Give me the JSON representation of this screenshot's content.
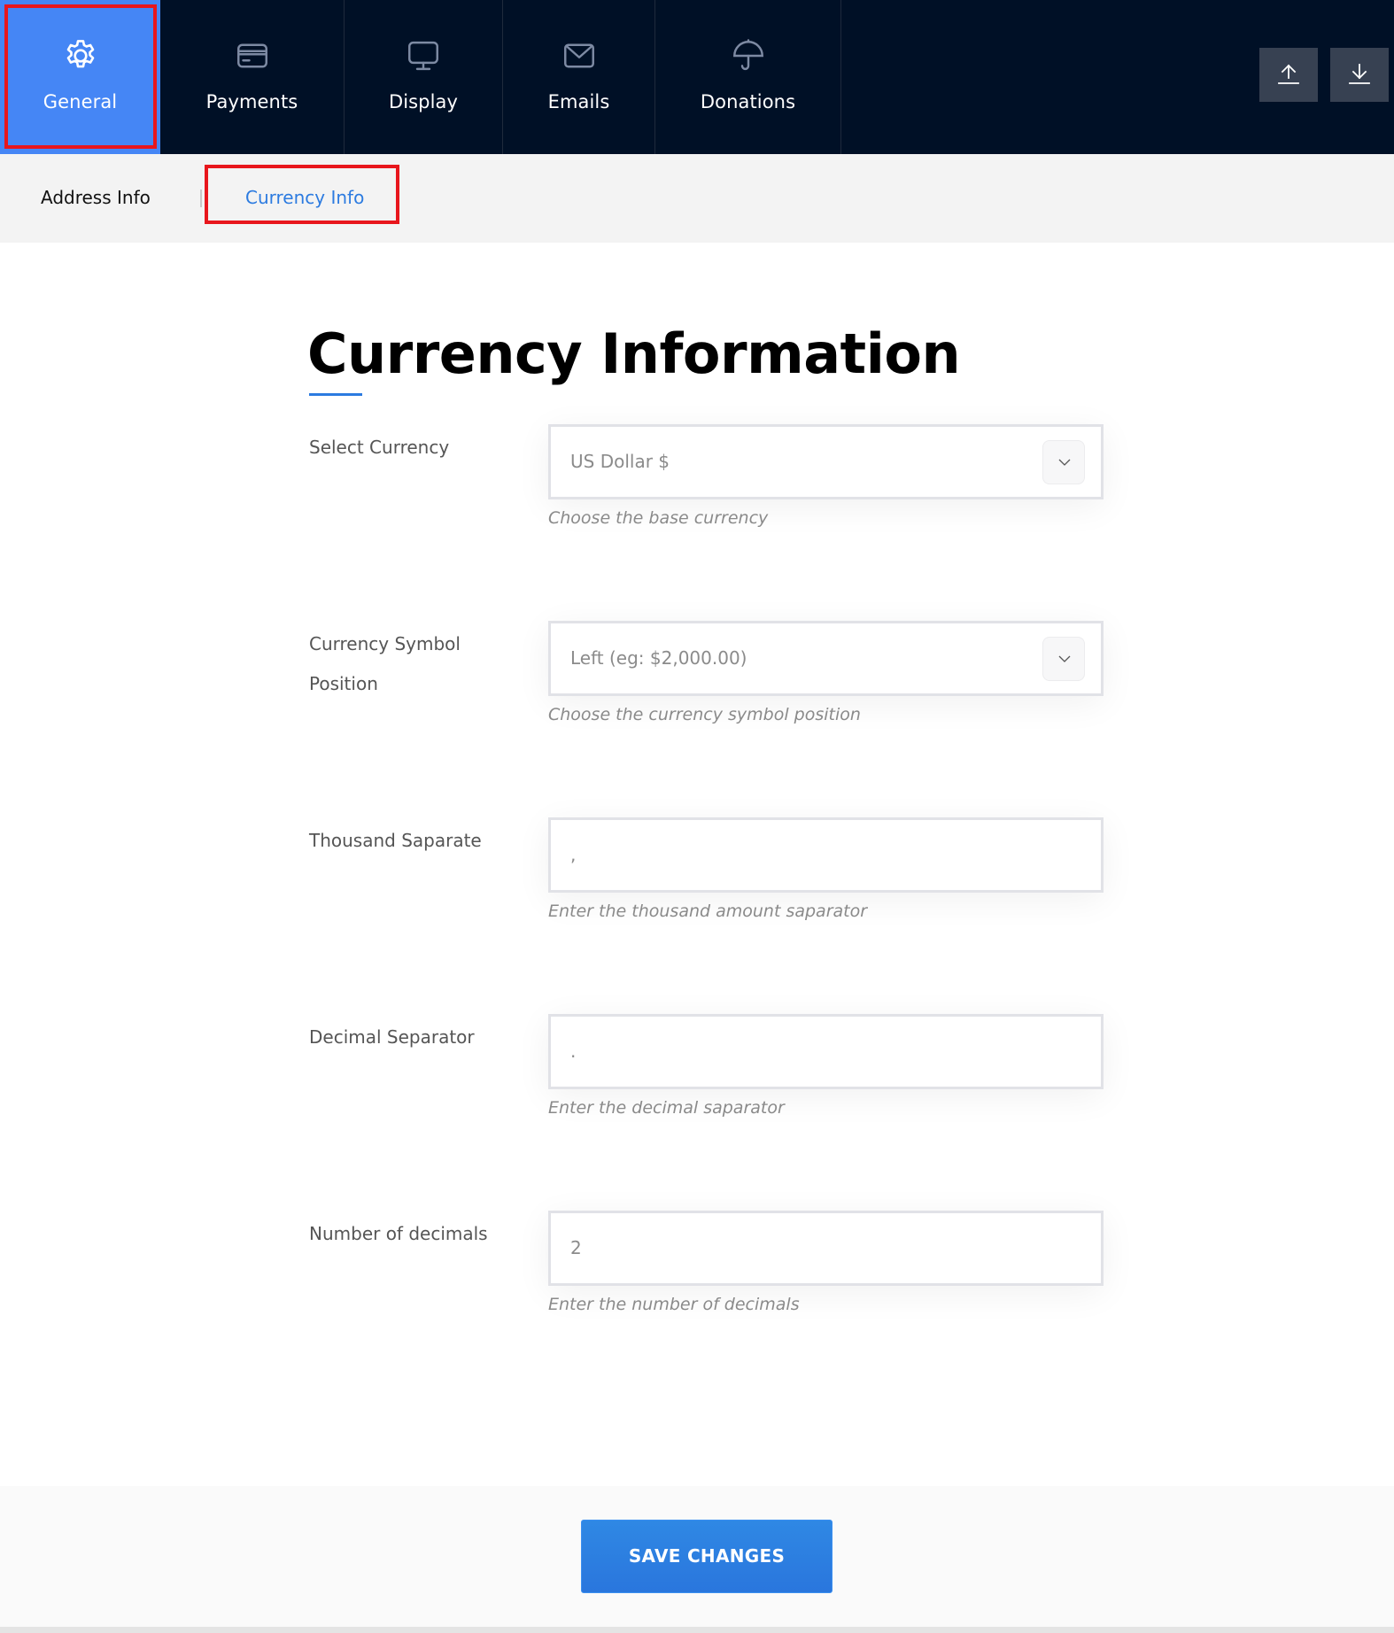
{
  "header": {
    "tabs": [
      {
        "id": "general",
        "label": "General",
        "icon": "gear-icon",
        "active": true
      },
      {
        "id": "payments",
        "label": "Payments",
        "icon": "credit-card-icon",
        "active": false
      },
      {
        "id": "display",
        "label": "Display",
        "icon": "monitor-icon",
        "active": false
      },
      {
        "id": "emails",
        "label": "Emails",
        "icon": "envelope-icon",
        "active": false
      },
      {
        "id": "donations",
        "label": "Donations",
        "icon": "umbrella-icon",
        "active": false
      }
    ],
    "actions": [
      {
        "id": "upload",
        "icon": "upload-icon"
      },
      {
        "id": "download",
        "icon": "download-icon"
      }
    ]
  },
  "subnav": {
    "items": [
      {
        "label": "Address Info",
        "active": false
      },
      {
        "label": "Currency Info",
        "active": true
      }
    ]
  },
  "main": {
    "title": "Currency Information",
    "fields": [
      {
        "label": "Select Currency",
        "type": "select",
        "value": "US Dollar $",
        "helper": "Choose the base currency"
      },
      {
        "label": "Currency Symbol Position",
        "type": "select",
        "value": "Left (eg: $2,000.00)",
        "helper": "Choose the currency symbol position"
      },
      {
        "label": "Thousand Saparate",
        "type": "text",
        "value": ",",
        "helper": "Enter the thousand amount saparator"
      },
      {
        "label": "Decimal Separator",
        "type": "text",
        "value": ".",
        "helper": "Enter the decimal saparator"
      },
      {
        "label": "Number of decimals",
        "type": "text",
        "value": "2",
        "helper": "Enter the number of decimals"
      }
    ]
  },
  "footer": {
    "save_label": "SAVE CHANGES"
  },
  "colors": {
    "header_bg": "#001026",
    "active_tab": "#4586f5",
    "accent": "#2c7be0",
    "highlight_box": "#e8161c",
    "action_button": "#374152"
  }
}
